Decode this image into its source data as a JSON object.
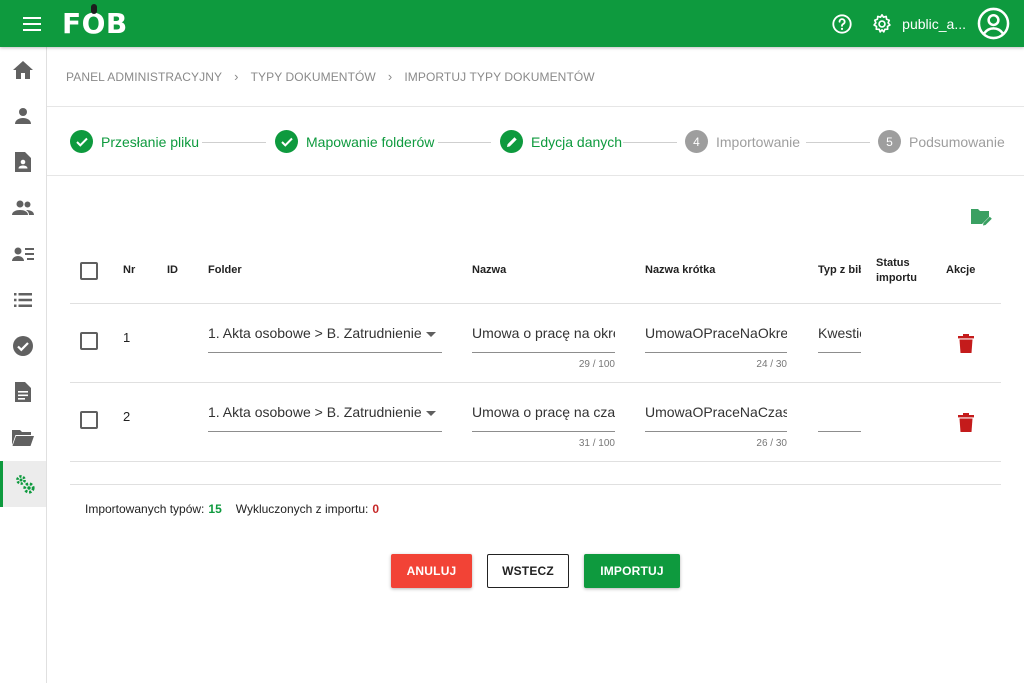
{
  "app": {
    "logo": "FOB",
    "username": "public_a..."
  },
  "colors": {
    "primary": "#0e9a3e",
    "danger": "#f24336",
    "delete_icon": "#c41b1b",
    "muted": "#9e9e9e"
  },
  "sidebar": {
    "items": [
      {
        "icon": "home-icon"
      },
      {
        "icon": "person-icon"
      },
      {
        "icon": "document-person-icon"
      },
      {
        "icon": "people-icon"
      },
      {
        "icon": "person-list-icon"
      },
      {
        "icon": "list-icon"
      },
      {
        "icon": "check-circle-icon"
      },
      {
        "icon": "file-icon"
      },
      {
        "icon": "folder-open-icon"
      },
      {
        "icon": "settings-gears-icon",
        "active": true
      }
    ]
  },
  "breadcrumb": [
    "PANEL ADMINISTRACYJNY",
    "TYPY DOKUMENTÓW",
    "IMPORTUJ TYPY DOKUMENTÓW"
  ],
  "stepper": {
    "steps": [
      {
        "label": "Przesłanie pliku",
        "state": "done",
        "marker": ""
      },
      {
        "label": "Mapowanie folderów",
        "state": "done",
        "marker": ""
      },
      {
        "label": "Edycja danych",
        "state": "editing",
        "marker": ""
      },
      {
        "label": "Importowanie",
        "state": "todo",
        "marker": "4"
      },
      {
        "label": "Podsumowanie",
        "state": "todo",
        "marker": "5"
      }
    ]
  },
  "table": {
    "headers": {
      "nr": "Nr",
      "id": "ID",
      "folder": "Folder",
      "nazwa": "Nazwa",
      "nazwa_krotka": "Nazwa krótka",
      "typ": "Typ z bib",
      "status_1": "Status",
      "status_2": "importu",
      "akcje": "Akcje"
    },
    "rows": [
      {
        "nr": "1",
        "id": "",
        "folder": "1. Akta osobowe > B. Zatrudnienie",
        "nazwa": "Umowa o pracę na okre",
        "nazwa_counter": "29 / 100",
        "nazwa_krotka": "UmowaOPraceNaOkres",
        "nazwa_krotka_counter": "24 / 30",
        "typ": "Kwestio",
        "status": ""
      },
      {
        "nr": "2",
        "id": "",
        "folder": "1. Akta osobowe > B. Zatrudnienie",
        "nazwa": "Umowa o pracę na czas",
        "nazwa_counter": "31 / 100",
        "nazwa_krotka": "UmowaOPraceNaCzasO",
        "nazwa_krotka_counter": "26 / 30",
        "typ": "",
        "status": ""
      }
    ]
  },
  "summary": {
    "imported_label": "Importowanych typów:",
    "imported_count": "15",
    "excluded_label": "Wykluczonych z importu:",
    "excluded_count": "0"
  },
  "buttons": {
    "cancel": "ANULUJ",
    "back": "WSTECZ",
    "import": "IMPORTUJ"
  }
}
